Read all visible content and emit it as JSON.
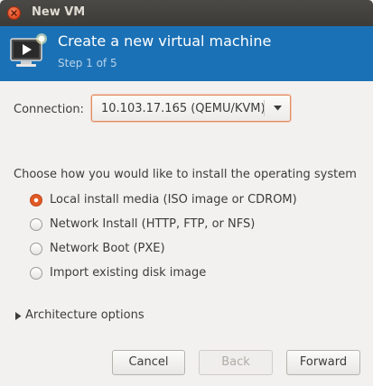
{
  "window": {
    "title": "New VM",
    "close_icon": "close-icon"
  },
  "header": {
    "title": "Create a new virtual machine",
    "subtitle": "Step 1 of 5",
    "icon": "virtual-machine-icon"
  },
  "connection": {
    "label": "Connection:",
    "value": "10.103.17.165 (QEMU/KVM)"
  },
  "install": {
    "label": "Choose how you would like to install the operating system",
    "options": [
      {
        "label": "Local install media (ISO image or CDROM)",
        "checked": true
      },
      {
        "label": "Network Install (HTTP, FTP, or NFS)",
        "checked": false
      },
      {
        "label": "Network Boot (PXE)",
        "checked": false
      },
      {
        "label": "Import existing disk image",
        "checked": false
      }
    ]
  },
  "architecture": {
    "label": "Architecture options",
    "expanded": false
  },
  "buttons": {
    "cancel": "Cancel",
    "back": "Back",
    "forward": "Forward",
    "back_enabled": false
  },
  "colors": {
    "header_bg": "#1b71b6",
    "accent": "#e05a24",
    "titlebar_bg": "#3c3b37"
  }
}
